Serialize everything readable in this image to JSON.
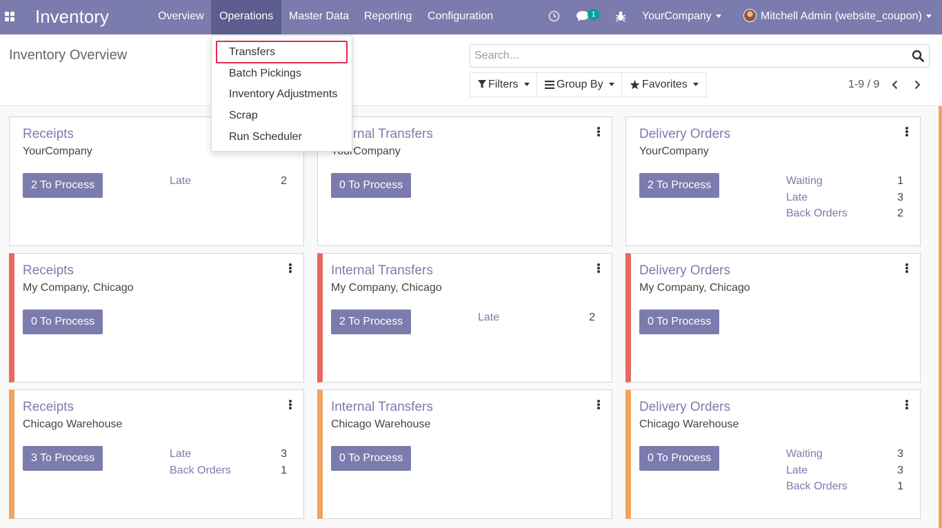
{
  "navbar": {
    "brand": "Inventory",
    "menus": [
      "Overview",
      "Operations",
      "Master Data",
      "Reporting",
      "Configuration"
    ],
    "active_menu": "Operations",
    "chat_badge": "1",
    "company": "YourCompany",
    "user": "Mitchell Admin (website_coupon)",
    "bg_color": "#7c7bad"
  },
  "operations_dropdown": {
    "items": [
      "Transfers",
      "Batch Pickings",
      "Inventory Adjustments",
      "Scrap",
      "Run Scheduler"
    ],
    "highlighted": "Transfers"
  },
  "control_panel": {
    "title": "Inventory Overview",
    "search_placeholder": "Search...",
    "filters_label": "Filters",
    "group_by_label": "Group By",
    "favorites_label": "Favorites",
    "pager": "1-9 / 9"
  },
  "cards": [
    {
      "title": "Receipts",
      "warehouse": "YourCompany",
      "button": "2 To Process",
      "stats": [
        {
          "label": "Late",
          "value": "2"
        }
      ]
    },
    {
      "title": "Internal Transfers",
      "warehouse": "YourCompany",
      "button": "0 To Process",
      "stats": []
    },
    {
      "title": "Delivery Orders",
      "warehouse": "YourCompany",
      "button": "2 To Process",
      "stats": [
        {
          "label": "Waiting",
          "value": "1"
        },
        {
          "label": "Late",
          "value": "3"
        },
        {
          "label": "Back Orders",
          "value": "2"
        }
      ]
    },
    {
      "title": "Receipts",
      "warehouse": "My Company, Chicago",
      "button": "0 To Process",
      "stats": []
    },
    {
      "title": "Internal Transfers",
      "warehouse": "My Company, Chicago",
      "button": "2 To Process",
      "stats": [
        {
          "label": "Late",
          "value": "2"
        }
      ]
    },
    {
      "title": "Delivery Orders",
      "warehouse": "My Company, Chicago",
      "button": "0 To Process",
      "stats": []
    },
    {
      "title": "Receipts",
      "warehouse": "Chicago Warehouse",
      "button": "3 To Process",
      "stats": [
        {
          "label": "Late",
          "value": "3"
        },
        {
          "label": "Back Orders",
          "value": "1"
        }
      ]
    },
    {
      "title": "Internal Transfers",
      "warehouse": "Chicago Warehouse",
      "button": "0 To Process",
      "stats": []
    },
    {
      "title": "Delivery Orders",
      "warehouse": "Chicago Warehouse",
      "button": "0 To Process",
      "stats": [
        {
          "label": "Waiting",
          "value": "3"
        },
        {
          "label": "Late",
          "value": "3"
        },
        {
          "label": "Back Orders",
          "value": "1"
        }
      ]
    }
  ]
}
